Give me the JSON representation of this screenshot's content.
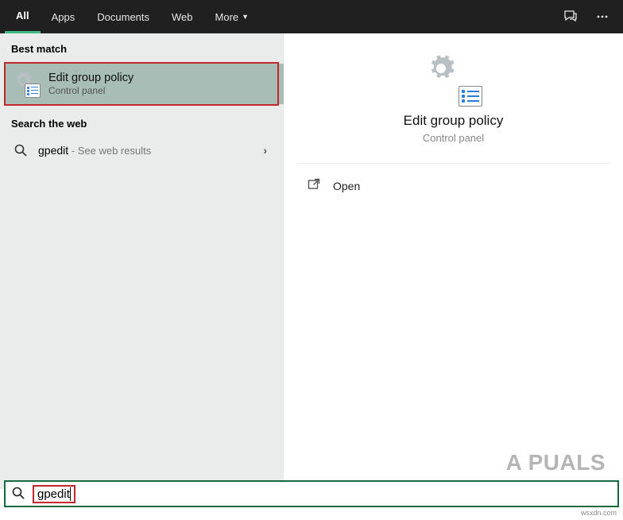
{
  "topbar": {
    "tabs": [
      {
        "label": "All",
        "active": true
      },
      {
        "label": "Apps",
        "active": false
      },
      {
        "label": "Documents",
        "active": false
      },
      {
        "label": "Web",
        "active": false
      },
      {
        "label": "More",
        "active": false,
        "caret": true
      }
    ]
  },
  "left": {
    "heading_best": "Best match",
    "best_match": {
      "title": "Edit group policy",
      "subtitle": "Control panel"
    },
    "heading_web": "Search the web",
    "web_result": {
      "query": "gpedit",
      "suffix": " - See web results"
    }
  },
  "preview": {
    "title": "Edit group policy",
    "subtitle": "Control panel",
    "actions": {
      "open": "Open"
    }
  },
  "search": {
    "value": "gpedit"
  },
  "watermark": {
    "logo": "A  PUALS",
    "site": "wsxdn.com"
  }
}
